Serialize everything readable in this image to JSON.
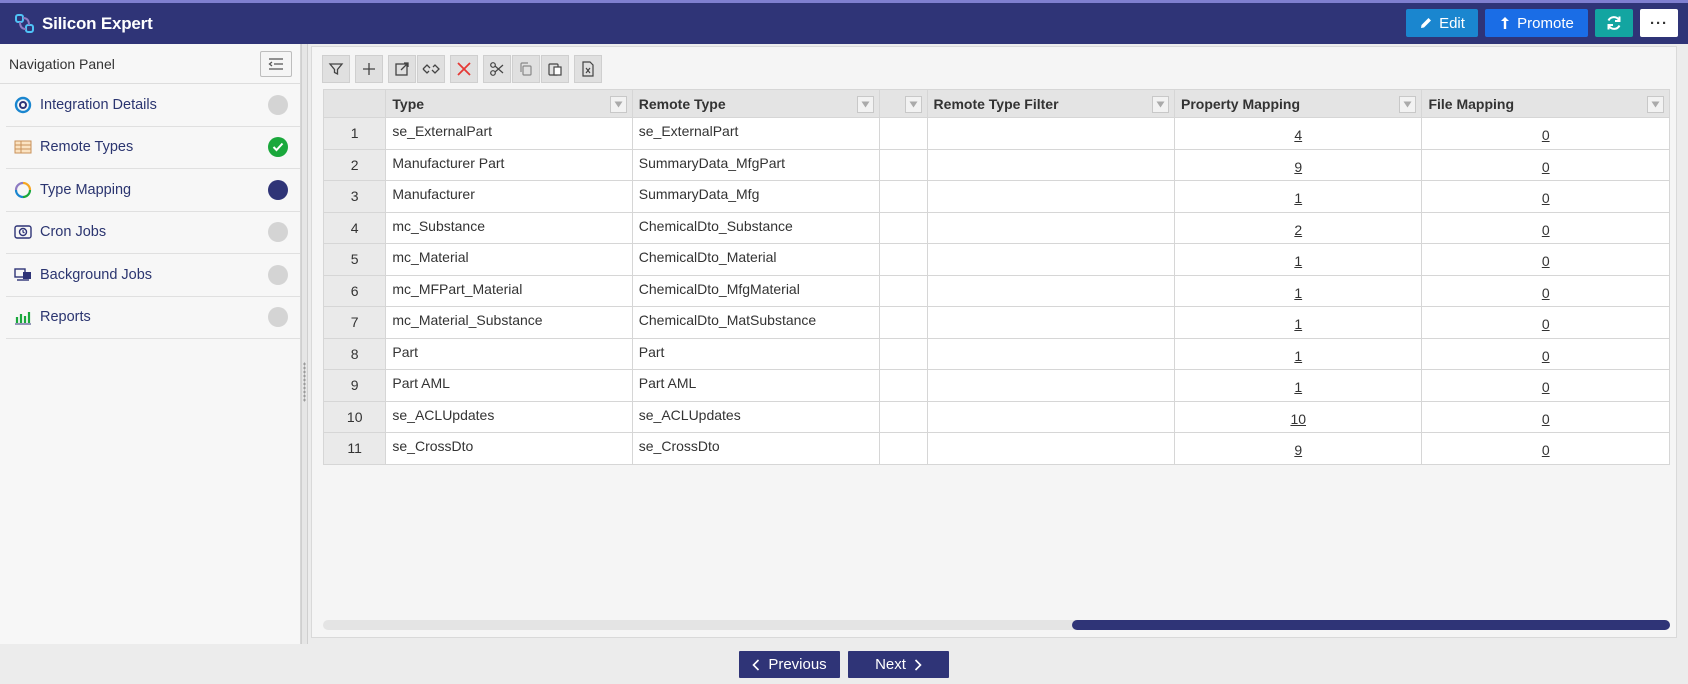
{
  "app": {
    "title": "Silicon Expert"
  },
  "header": {
    "edit_label": "Edit",
    "promote_label": "Promote",
    "more_label": "···"
  },
  "nav": {
    "title": "Navigation Panel",
    "items": [
      {
        "label": "Integration Details",
        "icon": "integration-icon",
        "status": "pending"
      },
      {
        "label": "Remote Types",
        "icon": "table-icon",
        "status": "done"
      },
      {
        "label": "Type Mapping",
        "icon": "mapping-icon",
        "status": "active"
      },
      {
        "label": "Cron Jobs",
        "icon": "cron-icon",
        "status": "pending"
      },
      {
        "label": "Background Jobs",
        "icon": "background-jobs-icon",
        "status": "pending"
      },
      {
        "label": "Reports",
        "icon": "bar-chart-icon",
        "status": "pending"
      }
    ]
  },
  "grid": {
    "columns": [
      "",
      "Type",
      "Remote Type",
      "",
      "Remote Type Filter",
      "Property Mapping",
      "File Mapping"
    ],
    "rows": [
      {
        "num": "1",
        "type": "se_ExternalPart",
        "remote": "se_ExternalPart",
        "filter": "",
        "prop": "4",
        "file": "0"
      },
      {
        "num": "2",
        "type": "Manufacturer Part",
        "remote": "SummaryData_MfgPart",
        "filter": "",
        "prop": "9",
        "file": "0"
      },
      {
        "num": "3",
        "type": "Manufacturer",
        "remote": "SummaryData_Mfg",
        "filter": "",
        "prop": "1",
        "file": "0"
      },
      {
        "num": "4",
        "type": "mc_Substance",
        "remote": "ChemicalDto_Substance",
        "filter": "",
        "prop": "2",
        "file": "0"
      },
      {
        "num": "5",
        "type": "mc_Material",
        "remote": "ChemicalDto_Material",
        "filter": "",
        "prop": "1",
        "file": "0"
      },
      {
        "num": "6",
        "type": "mc_MFPart_Material",
        "remote": "ChemicalDto_MfgMaterial",
        "filter": "",
        "prop": "1",
        "file": "0"
      },
      {
        "num": "7",
        "type": "mc_Material_Substance",
        "remote": "ChemicalDto_MatSubstance",
        "filter": "",
        "prop": "1",
        "file": "0"
      },
      {
        "num": "8",
        "type": "Part",
        "remote": "Part",
        "filter": "",
        "prop": "1",
        "file": "0"
      },
      {
        "num": "9",
        "type": "Part AML",
        "remote": "Part AML",
        "filter": "",
        "prop": "1",
        "file": "0"
      },
      {
        "num": "10",
        "type": "se_ACLUpdates",
        "remote": "se_ACLUpdates",
        "filter": "",
        "prop": "10",
        "file": "0"
      },
      {
        "num": "11",
        "type": "se_CrossDto",
        "remote": "se_CrossDto",
        "filter": "",
        "prop": "9",
        "file": "0"
      }
    ]
  },
  "footer": {
    "previous_label": "Previous",
    "next_label": "Next"
  },
  "colors": {
    "brand": "#2f3477",
    "edit": "#1a86cf",
    "promote": "#1a6de6",
    "refresh": "#13a5a1",
    "done": "#1aa83c"
  }
}
